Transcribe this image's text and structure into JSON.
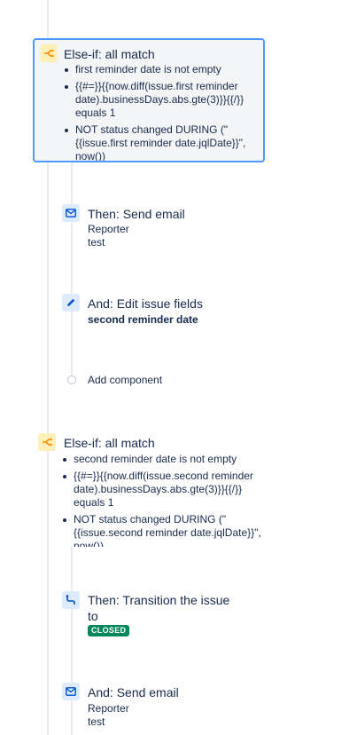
{
  "branches": [
    {
      "title": "Else-if: all match",
      "icon": "branch-icon",
      "selected": true,
      "conditions": [
        "first reminder date is not empty",
        "{{#=}}{{now.diff(issue.first reminder date).businessDays.abs.gte(3)}}{{/}} equals 1",
        "NOT status changed DURING (\"{{issue.first reminder date.jqlDate}}\", now())"
      ]
    },
    {
      "title": "Else-if: all match",
      "icon": "branch-icon",
      "selected": false,
      "conditions": [
        "second reminder date is not empty",
        "{{#=}}{{now.diff(issue.second reminder date).businessDays.abs.gte(3)}}{{/}} equals 1",
        "NOT status changed DURING (\"{{issue.second reminder date.jqlDate}}\", now())"
      ]
    }
  ],
  "actions": {
    "send_email_1": {
      "title": "Then: Send email",
      "line1": "Reporter",
      "line2": "test",
      "icon": "mail-icon"
    },
    "edit_fields": {
      "title": "And: Edit issue fields",
      "field": "second reminder date",
      "icon": "pencil-icon"
    },
    "add_component": {
      "label": "Add component"
    },
    "transition": {
      "title_line1": "Then: Transition the issue",
      "title_line2": "to",
      "status": "CLOSED",
      "status_color": "#00875a",
      "icon": "transition-icon"
    },
    "send_email_2": {
      "title": "And: Send email",
      "line1": "Reporter",
      "line2": "test",
      "icon": "mail-icon"
    }
  },
  "colors": {
    "selection_border": "#4c9aff",
    "branch_icon_bg": "#ffefb8",
    "action_icon_bg": "#deebff",
    "text": "#172b4d"
  }
}
